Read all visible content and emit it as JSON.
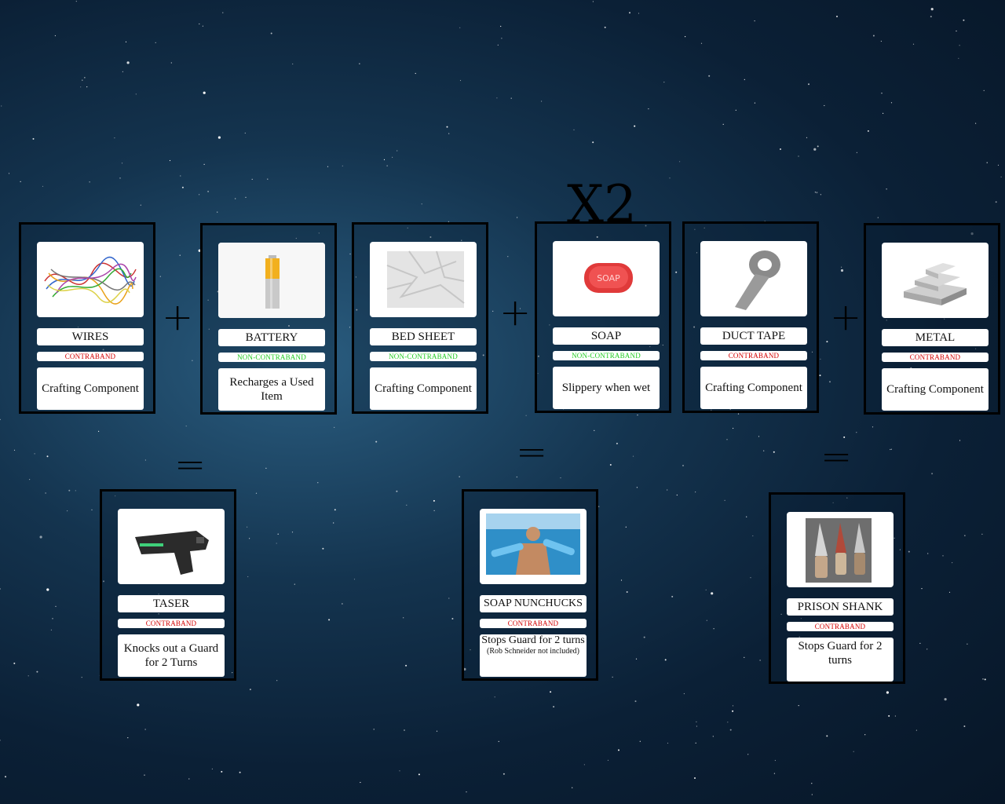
{
  "multiplier": "X2",
  "operators": {
    "plus": "+",
    "equals": "="
  },
  "ingredients": [
    {
      "name": "WIRES",
      "status": "CONTRABAND",
      "status_color": "#d40000",
      "desc": "Crafting Component",
      "icon": "wires-image"
    },
    {
      "name": "BATTERY",
      "status": "NON-CONTRABAND",
      "status_color": "#22cc22",
      "desc": "Recharges a Used Item",
      "icon": "battery-image"
    },
    {
      "name": "BED SHEET",
      "status": "NON-CONTRABAND",
      "status_color": "#22cc22",
      "desc": "Crafting Component",
      "icon": "bed-sheet-image"
    },
    {
      "name": "SOAP",
      "status": "NON-CONTRABAND",
      "status_color": "#22cc22",
      "desc": "Slippery when wet",
      "icon": "soap-image"
    },
    {
      "name": "DUCT TAPE",
      "status": "CONTRABAND",
      "status_color": "#d40000",
      "desc": "Crafting Component",
      "icon": "duct-tape-image"
    },
    {
      "name": "METAL",
      "status": "CONTRABAND",
      "status_color": "#d40000",
      "desc": "Crafting Component",
      "icon": "metal-image"
    }
  ],
  "results": [
    {
      "name": "TASER",
      "status": "CONTRABAND",
      "status_color": "#d40000",
      "desc": "Knocks out a Guard for 2 Turns",
      "note": "",
      "icon": "taser-image"
    },
    {
      "name": "SOAP NUNCHUCKS",
      "status": "CONTRABAND",
      "status_color": "#d40000",
      "desc": "Stops Guard for 2 turns",
      "note": "(Rob Schneider not included)",
      "icon": "soap-nunchucks-image"
    },
    {
      "name": "PRISON SHANK",
      "status": "CONTRABAND",
      "status_color": "#d40000",
      "desc": "Stops Guard for 2 turns",
      "note": "",
      "icon": "prison-shank-image"
    }
  ]
}
